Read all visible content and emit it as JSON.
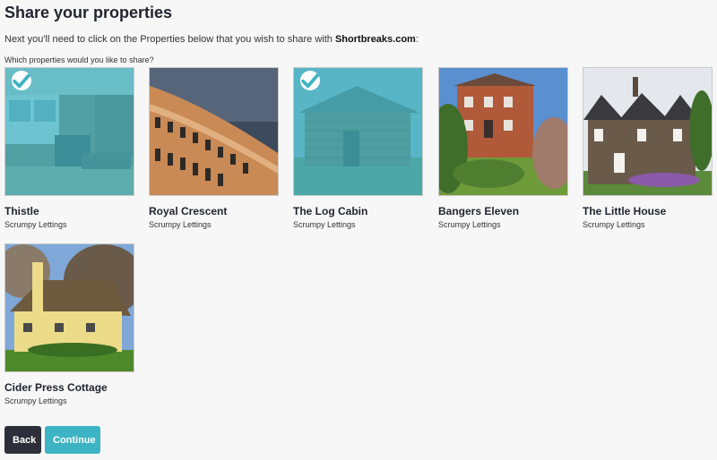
{
  "page": {
    "title": "Share your properties",
    "intro_prefix": "Next you'll need to click on the Properties below that you wish to share with ",
    "intro_brand": "Shortbreaks.com",
    "intro_suffix": ":",
    "question": "Which properties would you like to share?"
  },
  "colors": {
    "accent": "#3db4c4",
    "dark_button": "#2c2f3a"
  },
  "properties": [
    {
      "name": "Thistle",
      "owner": "Scrumpy Lettings",
      "selected": true,
      "icon": "interior-photo"
    },
    {
      "name": "Royal Crescent",
      "owner": "Scrumpy Lettings",
      "selected": false,
      "icon": "crescent-photo"
    },
    {
      "name": "The Log Cabin",
      "owner": "Scrumpy Lettings",
      "selected": true,
      "icon": "cabin-photo"
    },
    {
      "name": "Bangers Eleven",
      "owner": "Scrumpy Lettings",
      "selected": false,
      "icon": "brick-house-photo"
    },
    {
      "name": "The Little House",
      "owner": "Scrumpy Lettings",
      "selected": false,
      "icon": "stone-house-photo"
    },
    {
      "name": "Cider Press Cottage",
      "owner": "Scrumpy Lettings",
      "selected": false,
      "icon": "cottage-photo"
    }
  ],
  "buttons": {
    "back": "Back",
    "continue": "Continue"
  }
}
